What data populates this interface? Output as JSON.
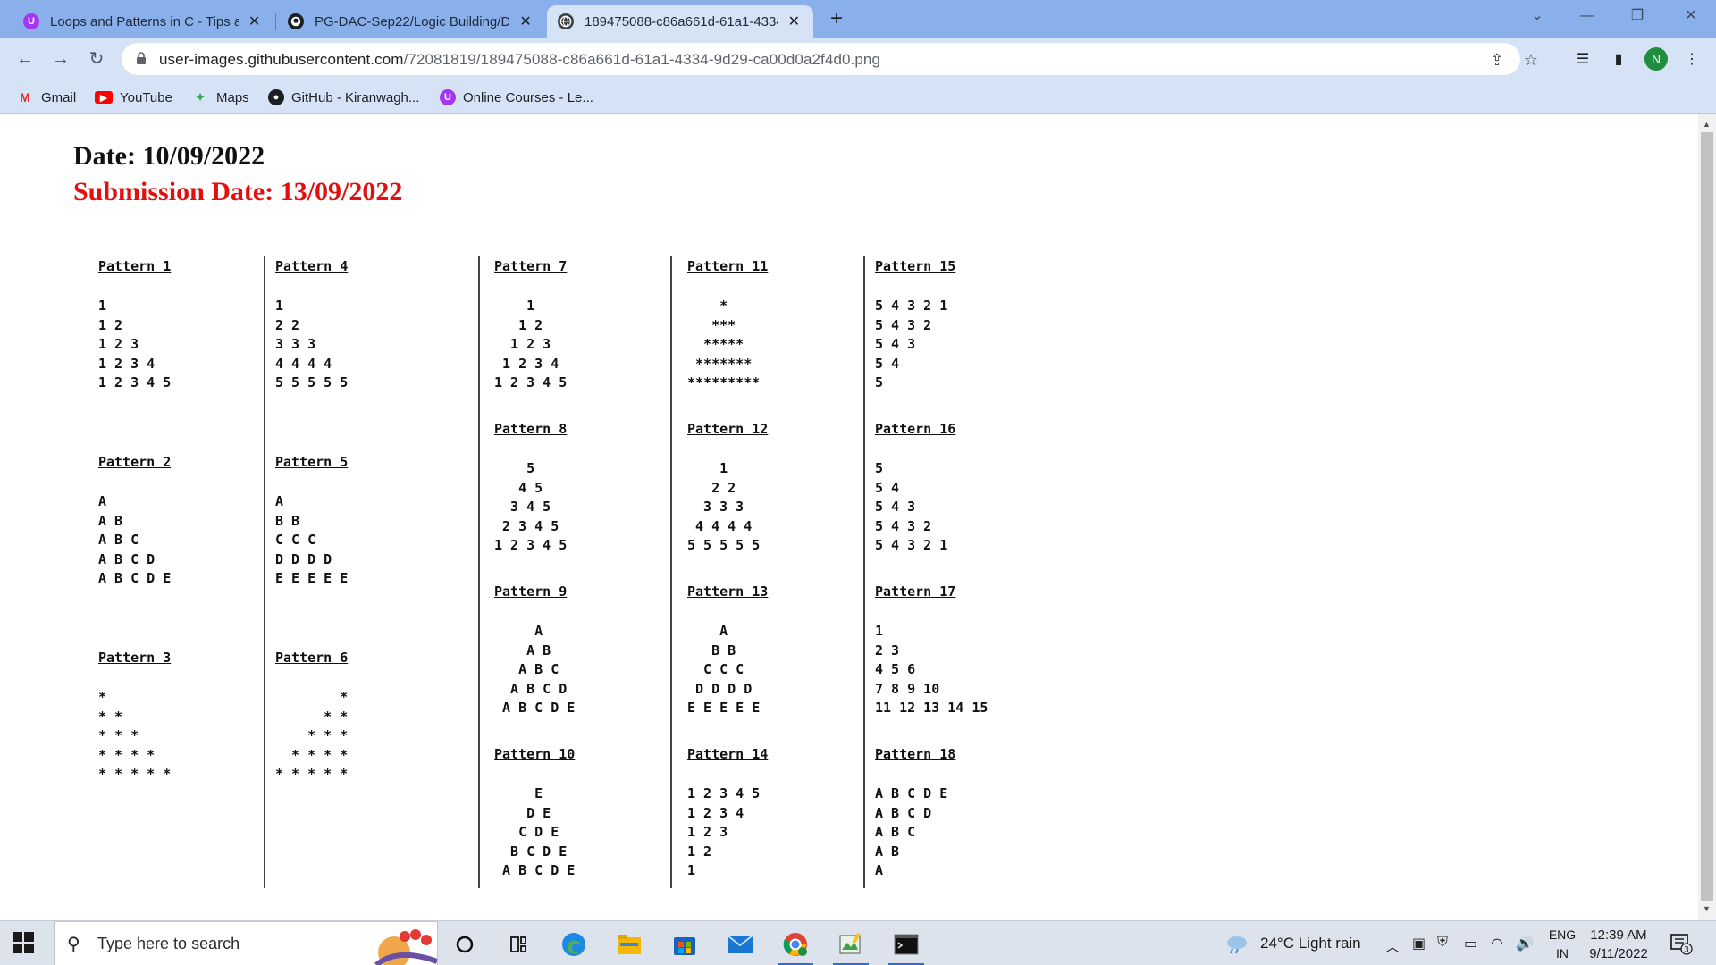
{
  "browser": {
    "tabs": [
      {
        "title": "Loops and Patterns in C - Tips an",
        "icon": "udemy-icon",
        "active": false
      },
      {
        "title": "PG-DAC-Sep22/Logic Building/D",
        "icon": "github-icon",
        "active": false
      },
      {
        "title": "189475088-c86a661d-61a1-4334",
        "icon": "globe-icon",
        "active": true
      }
    ],
    "url_domain": "user-images.githubusercontent.com",
    "url_path": "/72081819/189475088-c86a661d-61a1-4334-9d29-ca00d0a2f4d0.png",
    "profile_initial": "N",
    "bookmarks": [
      {
        "label": "Gmail",
        "icon": "gmail-icon"
      },
      {
        "label": "YouTube",
        "icon": "youtube-icon"
      },
      {
        "label": "Maps",
        "icon": "maps-icon"
      },
      {
        "label": "GitHub - Kiranwagh...",
        "icon": "github-icon"
      },
      {
        "label": "Online Courses - Le...",
        "icon": "udemy-icon"
      }
    ]
  },
  "document": {
    "date": "Date: 10/09/2022",
    "submission_date": "Submission Date: 13/09/2022",
    "patterns": [
      {
        "title": "Pattern 1",
        "lines": [
          "1",
          "1 2",
          "1 2 3",
          "1 2 3 4",
          "1 2 3 4 5"
        ]
      },
      {
        "title": "Pattern 2",
        "lines": [
          "A",
          "A B",
          "A B C",
          "A B C D",
          "A B C D E"
        ]
      },
      {
        "title": "Pattern 3",
        "lines": [
          "*",
          "* *",
          "* * *",
          "* * * *",
          "* * * * *"
        ]
      },
      {
        "title": "Pattern 4",
        "lines": [
          "1",
          "2 2",
          "3 3 3",
          "4 4 4 4",
          "5 5 5 5 5"
        ]
      },
      {
        "title": "Pattern 5",
        "lines": [
          "A",
          "B B",
          "C C C",
          "D D D D",
          "E E E E E"
        ]
      },
      {
        "title": "Pattern 6",
        "lines": [
          "        *",
          "      * *",
          "    * * *",
          "  * * * *",
          "* * * * *"
        ]
      },
      {
        "title": "Pattern 7",
        "lines": [
          "    1",
          "   1 2",
          "  1 2 3",
          " 1 2 3 4",
          "1 2 3 4 5"
        ]
      },
      {
        "title": "Pattern 8",
        "lines": [
          "    5",
          "   4 5",
          "  3 4 5",
          " 2 3 4 5",
          "1 2 3 4 5"
        ]
      },
      {
        "title": "Pattern 9",
        "lines": [
          "     A",
          "    A B",
          "   A B C",
          "  A B C D",
          " A B C D E"
        ]
      },
      {
        "title": "Pattern 10",
        "lines": [
          "     E",
          "    D E",
          "   C D E",
          "  B C D E",
          " A B C D E"
        ]
      },
      {
        "title": "Pattern 11",
        "lines": [
          "    *",
          "   ***",
          "  *****",
          " *******",
          "*********"
        ]
      },
      {
        "title": "Pattern 12",
        "lines": [
          "    1",
          "   2 2",
          "  3 3 3",
          " 4 4 4 4",
          "5 5 5 5 5"
        ]
      },
      {
        "title": "Pattern 13",
        "lines": [
          "    A",
          "   B B",
          "  C C C",
          " D D D D",
          "E E E E E"
        ]
      },
      {
        "title": "Pattern 14",
        "lines": [
          "1 2 3 4 5",
          "1 2 3 4",
          "1 2 3",
          "1 2",
          "1"
        ]
      },
      {
        "title": "Pattern 15",
        "lines": [
          "5 4 3 2 1",
          "5 4 3 2",
          "5 4 3",
          "5 4",
          "5"
        ]
      },
      {
        "title": "Pattern 16",
        "lines": [
          "5",
          "5 4",
          "5 4 3",
          "5 4 3 2",
          "5 4 3 2 1"
        ]
      },
      {
        "title": "Pattern 17",
        "lines": [
          "1",
          "2 3",
          "4 5 6",
          "7 8 9 10",
          "11 12 13 14 15"
        ]
      },
      {
        "title": "Pattern 18",
        "lines": [
          "A B C D E",
          "A B C D",
          "A B C",
          "A B",
          "A"
        ]
      }
    ]
  },
  "taskbar": {
    "search_placeholder": "Type here to search",
    "weather": "24°C  Light rain",
    "language_line1": "ENG",
    "language_line2": "IN",
    "time": "12:39 AM",
    "date": "9/11/2022",
    "notification_count": "3",
    "apps": [
      "cortana-icon",
      "task-view-icon",
      "edge-icon",
      "file-explorer-icon",
      "microsoft-store-icon",
      "mail-icon",
      "chrome-icon",
      "paint-icon",
      "terminal-icon"
    ]
  },
  "colors": {
    "tabstrip": "#8ab0ec",
    "toolbar": "#d6e3f7",
    "submission_red": "#e01010",
    "profile_green": "#1e8e3e"
  }
}
